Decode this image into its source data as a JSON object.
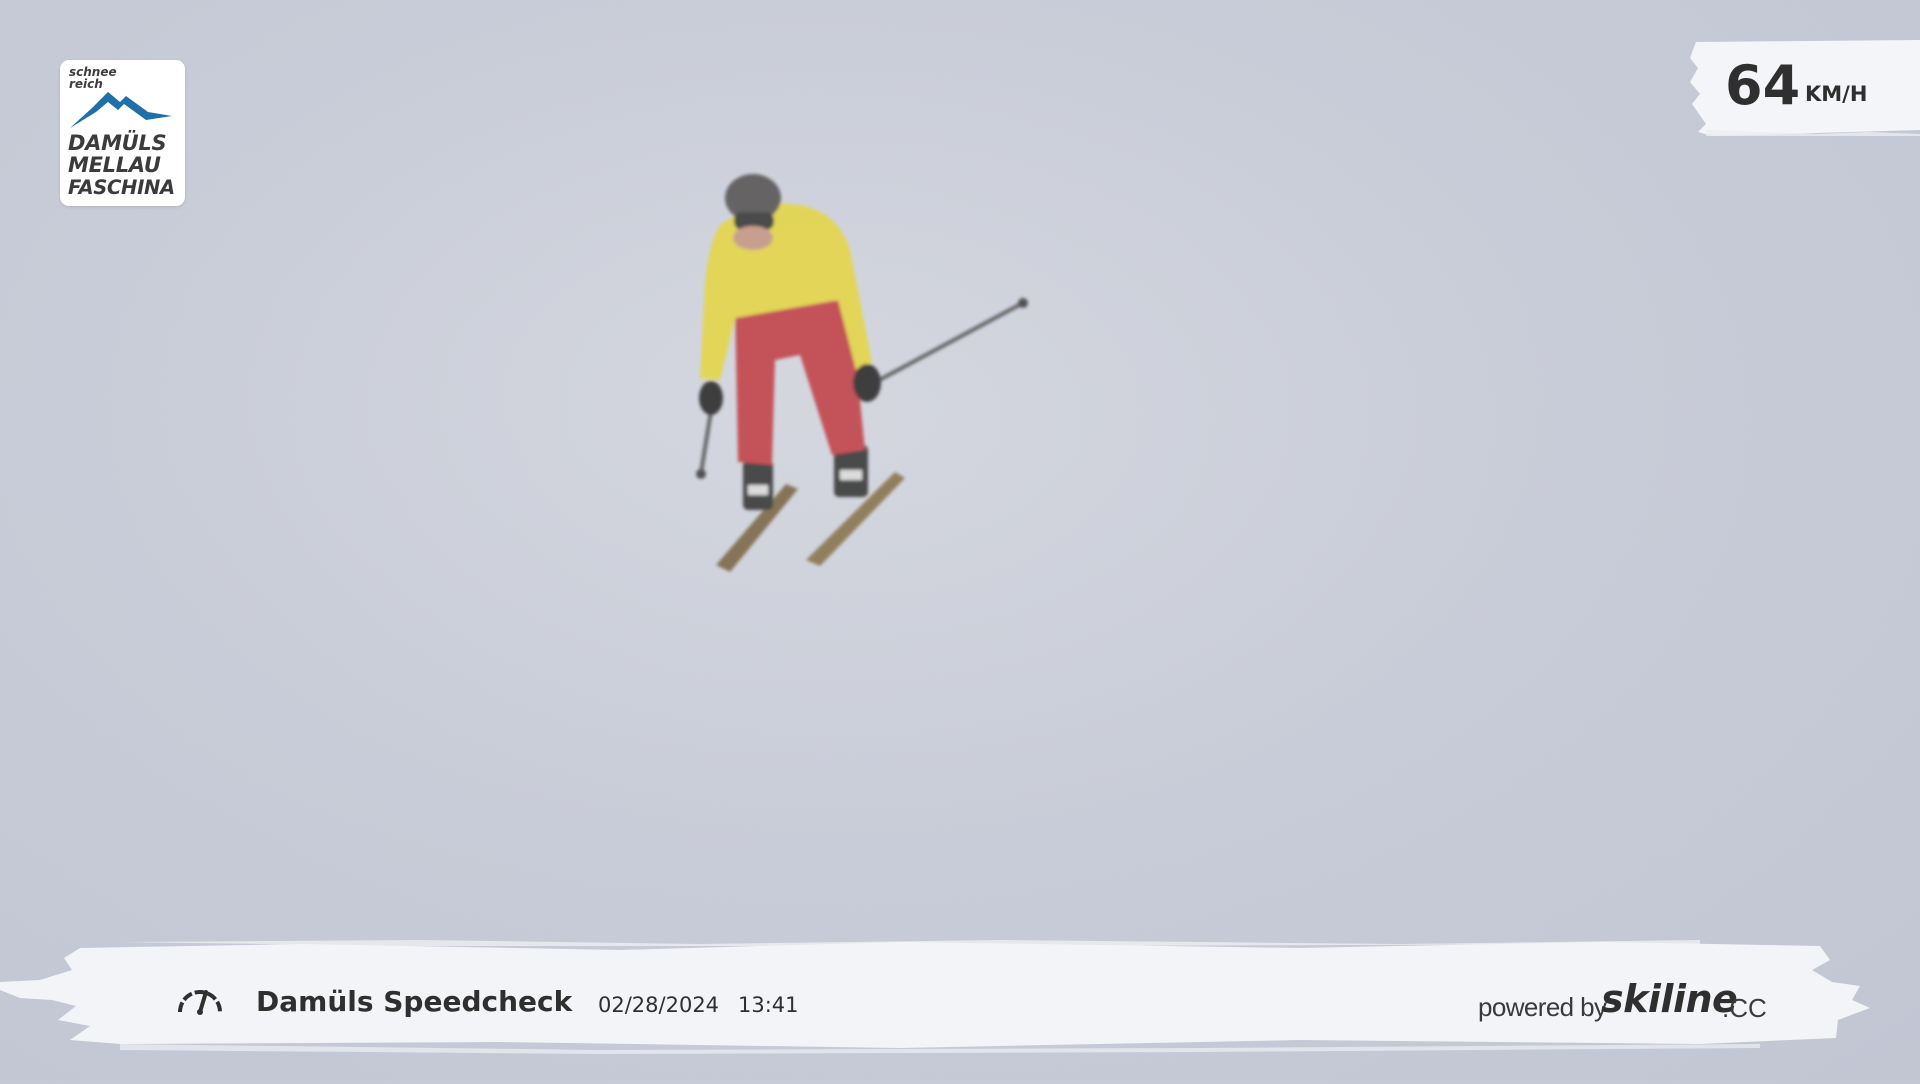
{
  "overlay": {
    "logo": {
      "tagline_1": "schnee",
      "tagline_2": "reich",
      "line_1": "DAMÜLS",
      "line_2": "MELLAU",
      "line_3": "FASCHINA"
    },
    "speed": {
      "value": "64",
      "unit": "KM/H"
    },
    "footer": {
      "title": "Damüls Speedcheck",
      "date": "02/28/2024",
      "time": "13:41",
      "powered_by": "powered by",
      "brand": "skiline",
      "brand_suffix": ".CC"
    }
  },
  "icons": {
    "speed_gauge": "speedometer-icon",
    "logo_mountain": "mountain-icon"
  },
  "colors": {
    "logo_blue": "#1f6fa8",
    "text_dark": "#2f2f2f",
    "jacket": "#e4d64a",
    "pants": "#c2454b"
  }
}
